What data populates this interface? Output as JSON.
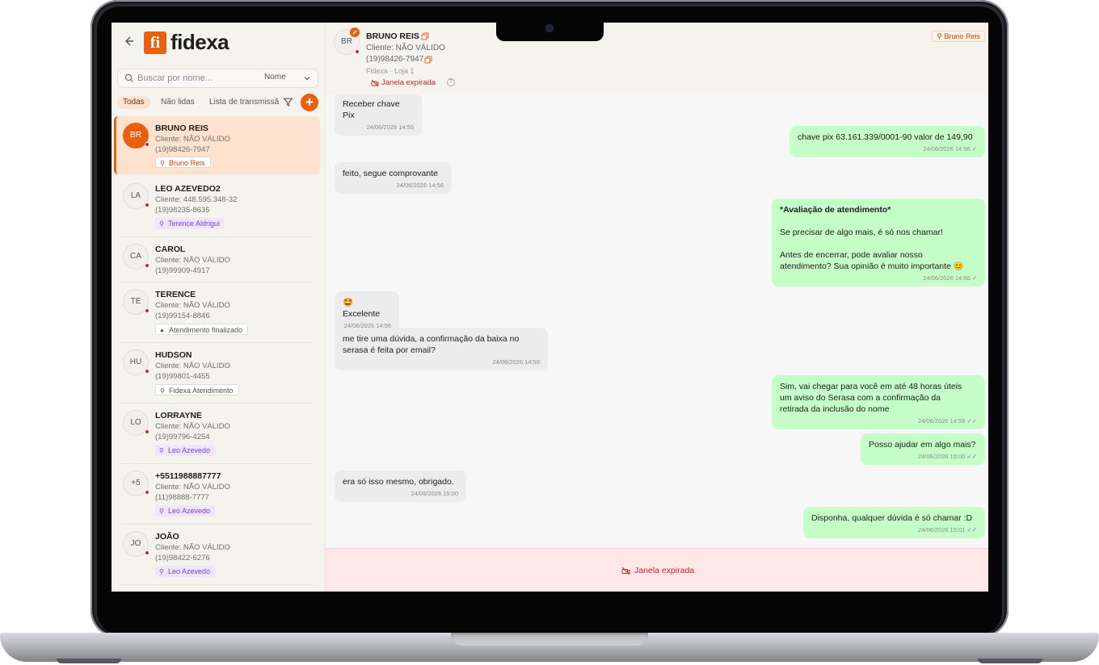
{
  "app": {
    "logo_mark": "fi",
    "logo_text": "fidexa"
  },
  "search": {
    "placeholder": "Buscar por nome...",
    "sort_label": "Nome"
  },
  "filters": {
    "all": "Todas",
    "unread": "Não lidas",
    "broadcast": "Lista de transmissã",
    "add": "+"
  },
  "conversations": [
    {
      "initials": "BR",
      "name": "BRUNO REIS",
      "cliente": "Cliente: NÃO VÁLIDO",
      "phone": "(19)98426-7947",
      "tag": "Bruno Reis"
    },
    {
      "initials": "LA",
      "name": "LEO AZEVEDO2",
      "cliente": "Cliente: 448.595.348-32",
      "phone": "(19)98235-8635",
      "tag": "Terence Aldrigui"
    },
    {
      "initials": "CA",
      "name": "CAROL",
      "cliente": "Cliente: NÃO VÁLIDO",
      "phone": "(19)99909-4917",
      "tag": ""
    },
    {
      "initials": "TE",
      "name": "TERENCE",
      "cliente": "Cliente: NÃO VÁLIDO",
      "phone": "(19)99154-8846",
      "tag": "Atendimento finalizado"
    },
    {
      "initials": "HU",
      "name": "HUDSON",
      "cliente": "Cliente: NÃO VÁLIDO",
      "phone": "(19)99801-4455",
      "tag": "Fidexa Atendimento"
    },
    {
      "initials": "LO",
      "name": "LORRAYNE",
      "cliente": "Cliente: NÃO VÁLIDO",
      "phone": "(19)99796-4254",
      "tag": "Leo Azevedo"
    },
    {
      "initials": "+5",
      "name": "+5511988887777",
      "cliente": "Cliente: NÃO VÁLIDO",
      "phone": "(11)98888-7777",
      "tag": "Leo Azevedo"
    },
    {
      "initials": "JO",
      "name": "JOÃO",
      "cliente": "Cliente: NÃO VÁLIDO",
      "phone": "(19)98422-6276",
      "tag": "Leo Azevedo"
    }
  ],
  "header": {
    "initials": "BR",
    "name": "BRUNO REIS",
    "cliente": "Cliente: NÃO VÁLIDO",
    "phone": "(19)98426-7947",
    "store": "Fidexa · Loja 1",
    "expired": "Janela expirada",
    "help": "?",
    "agent": "Bruno Reis"
  },
  "messages": [
    {
      "dir": "in",
      "text": "Receber chave Pix",
      "time": "24/06/2026 14:55"
    },
    {
      "dir": "out",
      "text": "chave pix 63.161.339/0001-90 valor de 149,90",
      "time": "24/06/2026 14:56",
      "check": "✓"
    },
    {
      "dir": "in",
      "text": "feito, segue comprovante",
      "time": "24/06/2026 14:56"
    },
    {
      "dir": "out",
      "title": "*Avaliação de atendimento*",
      "text": "Se precisar de algo mais, é só nos chamar!\n\nAntes de encerrar, pode avaliar nosso\natendimento? Sua opinião é muito importante 😊",
      "time": "24/06/2026 14:56",
      "check": "✓"
    },
    {
      "dir": "in",
      "text": "🤩 Excelente",
      "time": "24/06/2026 14:56"
    },
    {
      "dir": "in",
      "text": "me tire uma dúvida, a confirmação da baixa no\nserasa é feita por email?",
      "time": "24/06/2026 14:59"
    },
    {
      "dir": "out",
      "text": "Sim, vai chegar para você em até 48 horas úteis\num aviso do Serasa com a confirmação da\nretirada da inclusão do nome",
      "time": "24/06/2026 14:59",
      "check": "✓✓"
    },
    {
      "dir": "out",
      "text": "Posso ajudar em algo mais?",
      "time": "24/06/2026 15:00",
      "check": "✓✓"
    },
    {
      "dir": "in",
      "text": "era só isso mesmo, obrigado.",
      "time": "24/06/2026 15:00"
    },
    {
      "dir": "out",
      "text": "Disponha, qualquer dúvida é só chamar :D",
      "time": "24/06/2026 15:01",
      "check": "✓✓"
    }
  ],
  "footer": {
    "expired": "Janela expirada"
  },
  "colors": {
    "accent": "#e8610e",
    "outgoing": "#c6fec8",
    "incoming": "#ececec",
    "danger": "#c62828",
    "tag_purple": "#7b3fe4"
  },
  "icons": {
    "back": "arrow-left-icon",
    "search": "search-icon",
    "chevron": "chevron-down-icon",
    "filter": "filter-icon",
    "person": "person-icon",
    "copy": "copy-icon",
    "edit": "pencil-icon",
    "expired": "video-off-icon",
    "help": "help-circle-icon"
  }
}
